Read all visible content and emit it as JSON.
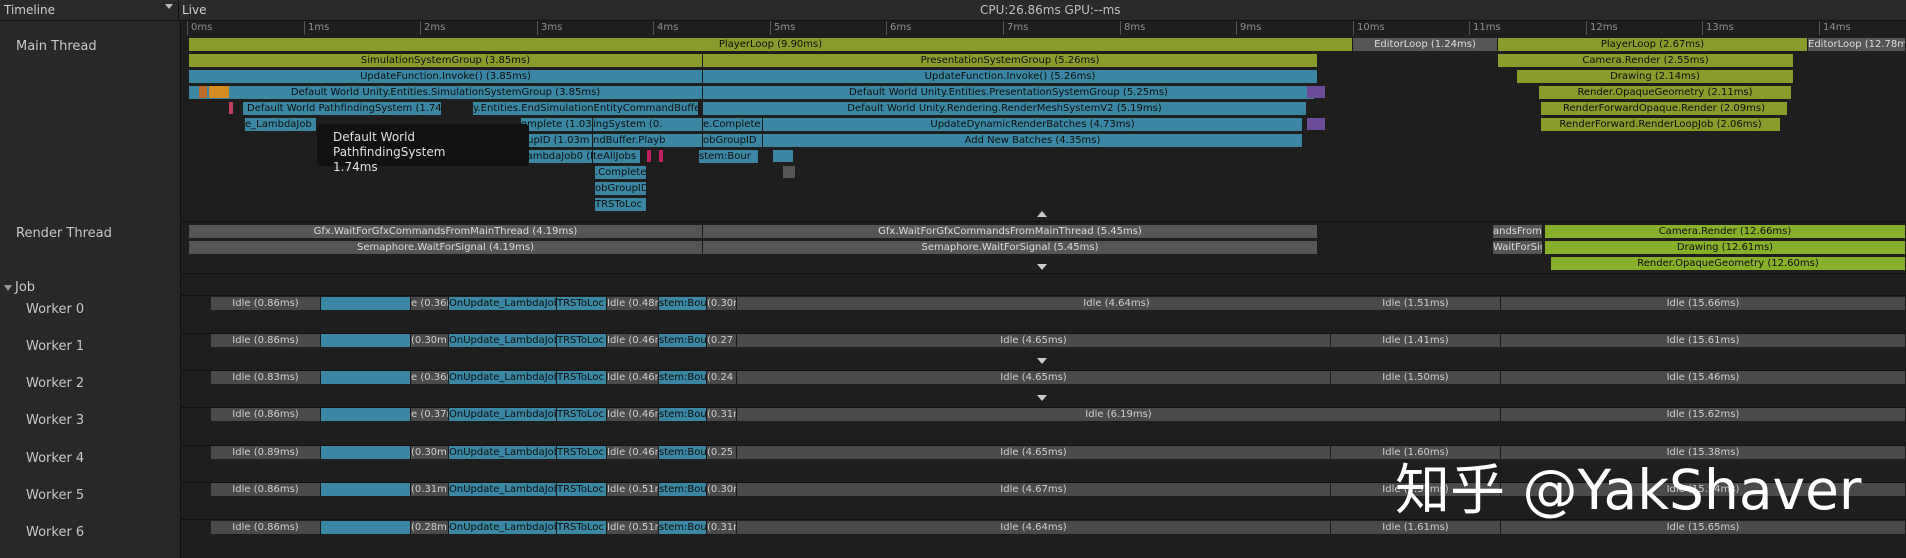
{
  "header": {
    "timeline_label": "Timeline",
    "live_label": "Live",
    "cpu_gpu": "CPU:26.86ms   GPU:--ms"
  },
  "ruler": {
    "ticks": [
      "0ms",
      "1ms",
      "2ms",
      "3ms",
      "4ms",
      "5ms",
      "6ms",
      "7ms",
      "8ms",
      "9ms",
      "10ms",
      "11ms",
      "12ms",
      "13ms",
      "14ms"
    ]
  },
  "threads": {
    "main": "Main Thread",
    "render": "Render Thread",
    "job_group": "Job",
    "workers": [
      "Worker 0",
      "Worker 1",
      "Worker 2",
      "Worker 3",
      "Worker 4",
      "Worker 5",
      "Worker 6"
    ]
  },
  "main_thread": {
    "row0": [
      "PlayerLoop (9.90ms)",
      "EditorLoop (1.24ms)",
      "PlayerLoop (2.67ms)",
      "EditorLoop (12.78ms)"
    ],
    "row1": [
      "SimulationSystemGroup (3.85ms)",
      "PresentationSystemGroup (5.26ms)",
      "Camera.Render (2.55ms)"
    ],
    "row2": [
      "UpdateFunction.Invoke() (3.85ms)",
      "UpdateFunction.Invoke() (5.26ms)",
      "Drawing (2.14ms)"
    ],
    "row3": [
      "Default World Unity.Entities.SimulationSystemGroup (3.85ms)",
      "Default World Unity.Entities.PresentationSystemGroup (5.25ms)",
      "Render.OpaqueGeometry (2.11ms)"
    ],
    "row4": [
      "Default World PathfindingSystem (1.74ms)",
      "y.Entities.EndSimulationEntityCommandBuffe",
      "Default World Unity.Rendering.RenderMeshSystemV2 (5.19ms)",
      "RenderForwardOpaque.Render (2.09ms)"
    ],
    "row5": [
      "e_LambdaJob",
      "omplete (1.03m",
      "ingSystem (0.",
      "e.Complete",
      "UpdateDynamicRenderBatches (4.73ms)",
      "RenderForward.RenderLoopJob (2.06ms)"
    ],
    "row6": [
      "oupID (1.03m",
      "ndBuffer.Playb",
      "obGroupID",
      "Add New Batches (4.35ms)"
    ],
    "row7": [
      "LambdaJob0 (B",
      "teAllJobs",
      "stem:Bour"
    ],
    "row8": [
      ".Complete"
    ],
    "row9": [
      "obGroupID"
    ],
    "row10": [
      "TRSToLoc"
    ]
  },
  "tooltip": {
    "title": "Default World PathfindingSystem",
    "value": "1.74ms"
  },
  "render_thread": {
    "row0": [
      "Gfx.WaitForGfxCommandsFromMainThread (4.19ms)",
      "Gfx.WaitForGfxCommandsFromMainThread (5.45ms)",
      "andsFrom",
      "Camera.Render (12.66ms)"
    ],
    "row1": [
      "Semaphore.WaitForSignal (4.19ms)",
      "Semaphore.WaitForSignal (5.45ms)",
      "WaitForSig",
      "Drawing (12.61ms)"
    ],
    "row2": [
      "Render.OpaqueGeometry (12.60ms)"
    ]
  },
  "workers": [
    {
      "s1": "Idle (0.86ms)",
      "s2": "e (0.36m",
      "job": "OnUpdate_LambdaJob0 (Bu",
      "trs": "TRSToLoc",
      "s3": "Idle (0.48ms",
      "sys": "stem:Bour",
      "s4": "(0.30n",
      "s5": "Idle (4.64ms)",
      "s6": "Idle (1.51ms)",
      "s7": "Idle (15.66ms)"
    },
    {
      "s1": "Idle (0.86ms)",
      "s2": "(0.30m",
      "job": "OnUpdate_LambdaJob0 (Bu",
      "trs": "TRSToLoc",
      "s3": "Idle (0.46ms",
      "sys": "stem:Bour",
      "s4": "(0.27",
      "s5": "Idle (4.65ms)",
      "s6": "Idle (1.41ms)",
      "s7": "Idle (15.61ms)"
    },
    {
      "s1": "Idle (0.83ms)",
      "s2": "e (0.36m",
      "job": "OnUpdate_LambdaJob0 (Bu",
      "trs": "TRSToLoc",
      "s3": "Idle (0.46ms",
      "sys": "stem:Bour",
      "s4": "(0.24",
      "s5": "Idle (4.65ms)",
      "s6": "Idle (1.50ms)",
      "s7": "Idle (15.46ms)"
    },
    {
      "s1": "Idle (0.86ms)",
      "s2": "e (0.37m",
      "job": "OnUpdate_LambdaJob0 (Bu",
      "trs": "TRSToLoc",
      "s3": "Idle (0.46ms",
      "sys": "stem:Bour",
      "s4": "(0.31n",
      "s5": "Idle (6.19ms)",
      "s6": "",
      "s7": "Idle (15.62ms)"
    },
    {
      "s1": "Idle (0.89ms)",
      "s2": "(0.30m",
      "job": "OnUpdate_LambdaJob0 (Bu",
      "trs": "TRSToLoc",
      "s3": "Idle (0.46ms",
      "sys": "stem:Bour",
      "s4": "(0.25",
      "s5": "Idle (4.65ms)",
      "s6": "Idle (1.60ms)",
      "s7": "Idle (15.38ms)"
    },
    {
      "s1": "Idle (0.86ms)",
      "s2": "(0.31m",
      "job": "OnUpdate_LambdaJob0 (Bu",
      "trs": "TRSToLoc",
      "s3": "Idle (0.51ms",
      "sys": "stem:Bour",
      "s4": "(0.30n",
      "s5": "Idle (4.67ms)",
      "s6": "Idle (1.51ms)",
      "s7": "Idle (15.54ms)"
    },
    {
      "s1": "Idle (0.86ms)",
      "s2": "(0.28m",
      "job": "OnUpdate_LambdaJob0 (Bu",
      "trs": "TRSToLoc",
      "s3": "Idle (0.51ms",
      "sys": "stem:Bour",
      "s4": "(0.31n",
      "s5": "Idle (4.64ms)",
      "s6": "Idle (1.61ms)",
      "s7": "Idle (15.65ms)"
    }
  ],
  "watermark": "知乎 @YakShaver"
}
